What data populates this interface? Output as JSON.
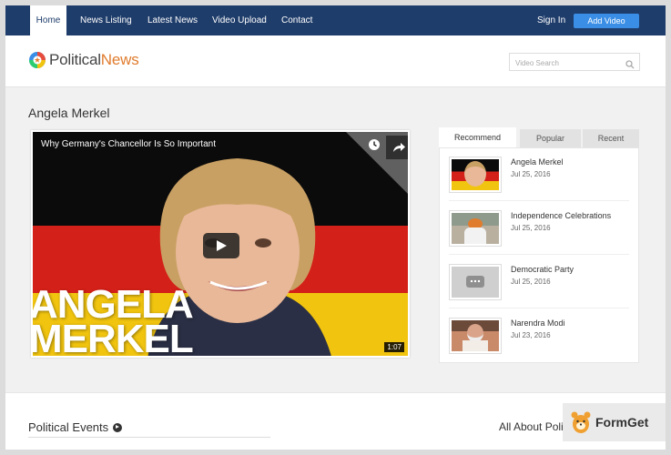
{
  "nav": {
    "items": [
      "Home",
      "News Listing",
      "Latest News",
      "Video Upload",
      "Contact"
    ],
    "signin": "Sign In",
    "add_video": "Add Video"
  },
  "header": {
    "logo_part1": "Political",
    "logo_part2": "News",
    "search_placeholder": "Video Search"
  },
  "main": {
    "page_title": "Angela Merkel",
    "video": {
      "title": "Why Germany's Chancellor Is So Important",
      "overlay_line1": "ANGELA",
      "overlay_line2": "MERKEL",
      "duration": "1:07"
    }
  },
  "sidebar": {
    "tabs": [
      "Recommend",
      "Popular",
      "Recent"
    ],
    "items": [
      {
        "title": "Angela Merkel",
        "date": "Jul 25, 2016"
      },
      {
        "title": "Independence Celebrations",
        "date": "Jul 25, 2016"
      },
      {
        "title": "Democratic Party",
        "date": "Jul 25, 2016"
      },
      {
        "title": "Narendra Modi",
        "date": "Jul 23, 2016"
      }
    ]
  },
  "footer": {
    "section_title": "Political Events",
    "all_about": "All About Poli",
    "watermark": "FormGet"
  },
  "colors": {
    "nav_bg": "#1f3d6b",
    "accent_blue": "#3a8ee6",
    "logo_orange": "#e07c2e"
  }
}
